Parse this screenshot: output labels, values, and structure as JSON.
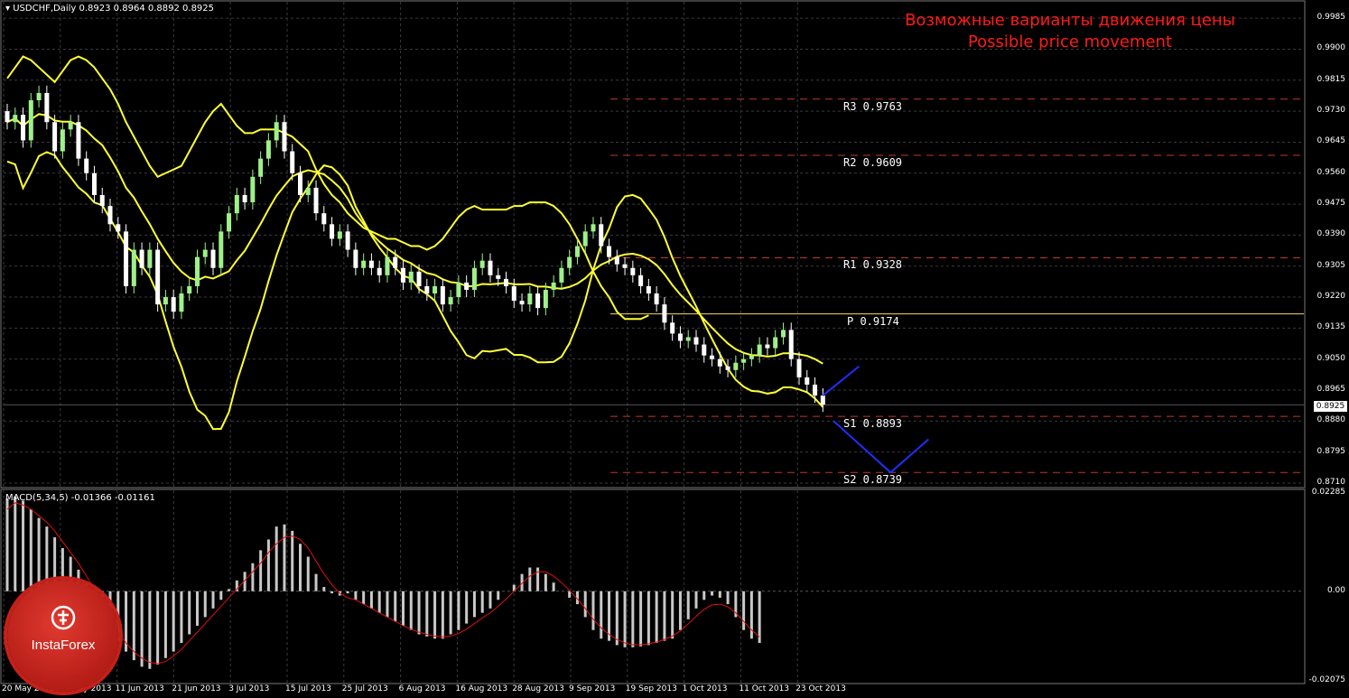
{
  "chart_data": [
    {
      "type": "candlestick",
      "title": "USDCHF,Daily",
      "ohlc_header": "0.8923 0.8964 0.8892 0.8925",
      "caption_line1": "Возможные варианты движения цены",
      "caption_line2": "Possible price movement",
      "y_ticks": [
        "0.9985",
        "0.9900",
        "0.9815",
        "0.9730",
        "0.9645",
        "0.9560",
        "0.9475",
        "0.9390",
        "0.9305",
        "0.9220",
        "0.9135",
        "0.9050",
        "0.8965",
        "0.8880",
        "0.8795",
        "0.8710"
      ],
      "ylim": [
        0.87,
        1.003
      ],
      "current_price": "0.8925",
      "x_ticks": [
        "20 May 2013",
        "30 May 2013",
        "11 Jun 2013",
        "21 Jun 2013",
        "3 Jul 2013",
        "15 Jul 2013",
        "25 Jul 2013",
        "6 Aug 2013",
        "16 Aug 2013",
        "28 Aug 2013",
        "9 Sep 2013",
        "19 Sep 2013",
        "1 Oct 2013",
        "11 Oct 2013",
        "23 Oct 2013"
      ],
      "levels": [
        {
          "name": "R3",
          "value": 0.9763,
          "text": "R3 0.9763",
          "color": "#c0392b"
        },
        {
          "name": "R2",
          "value": 0.9609,
          "text": "R2 0.9609",
          "color": "#c0392b"
        },
        {
          "name": "R1",
          "value": 0.9328,
          "text": "R1 0.9328",
          "color": "#c0392b"
        },
        {
          "name": "P",
          "value": 0.9174,
          "text": "P 0.9174",
          "color": "#f5d76e"
        },
        {
          "name": "S1",
          "value": 0.8893,
          "text": "S1 0.8893",
          "color": "#c0392b"
        },
        {
          "name": "S2",
          "value": 0.8739,
          "text": "S2 0.8739",
          "color": "#c0392b"
        }
      ],
      "close": [
        0.97,
        0.972,
        0.965,
        0.976,
        0.978,
        0.97,
        0.962,
        0.968,
        0.97,
        0.96,
        0.956,
        0.95,
        0.947,
        0.942,
        0.94,
        0.925,
        0.935,
        0.93,
        0.935,
        0.92,
        0.922,
        0.918,
        0.923,
        0.925,
        0.933,
        0.935,
        0.93,
        0.94,
        0.945,
        0.95,
        0.948,
        0.955,
        0.96,
        0.965,
        0.97,
        0.962,
        0.956,
        0.95,
        0.952,
        0.945,
        0.942,
        0.938,
        0.94,
        0.935,
        0.93,
        0.932,
        0.93,
        0.928,
        0.933,
        0.93,
        0.926,
        0.929,
        0.925,
        0.923,
        0.925,
        0.92,
        0.922,
        0.926,
        0.924,
        0.93,
        0.932,
        0.928,
        0.927,
        0.925,
        0.921,
        0.92,
        0.923,
        0.919,
        0.924,
        0.926,
        0.93,
        0.933,
        0.936,
        0.94,
        0.942,
        0.936,
        0.933,
        0.931,
        0.93,
        0.928,
        0.925,
        0.923,
        0.92,
        0.915,
        0.912,
        0.91,
        0.911,
        0.909,
        0.906,
        0.905,
        0.903,
        0.902,
        0.904,
        0.905,
        0.906,
        0.909,
        0.908,
        0.911,
        0.913,
        0.905,
        0.9,
        0.898,
        0.895,
        0.8925
      ],
      "bollinger_upper": [
        0.982,
        0.985,
        0.988,
        0.987,
        0.985,
        0.983,
        0.981,
        0.984,
        0.987,
        0.988,
        0.987,
        0.985,
        0.982,
        0.979,
        0.975,
        0.97,
        0.966,
        0.962,
        0.958,
        0.955,
        0.956,
        0.957,
        0.958,
        0.962,
        0.966,
        0.97,
        0.973,
        0.975,
        0.972,
        0.969,
        0.967,
        0.967,
        0.968,
        0.968,
        0.968,
        0.967,
        0.966,
        0.964,
        0.962,
        0.957,
        0.953,
        0.95,
        0.948,
        0.945,
        0.943,
        0.941,
        0.94,
        0.939,
        0.938,
        0.938,
        0.937,
        0.936,
        0.936,
        0.935,
        0.936,
        0.938,
        0.941,
        0.944,
        0.946,
        0.947,
        0.946,
        0.946,
        0.946,
        0.946,
        0.947,
        0.947,
        0.948,
        0.948,
        0.948,
        0.947,
        0.945,
        0.942,
        0.938,
        0.934,
        0.929,
        0.925,
        0.922,
        0.918,
        0.916,
        0.916,
        0.916,
        0.917
      ]
    },
    {
      "type": "histogram",
      "title": "MACD(5,34,5) -0.01366 -0.01161",
      "y_ticks": [
        "0.02285",
        "0.00",
        "-0.02075"
      ],
      "ylim": [
        -0.0212,
        0.0234
      ],
      "histogram": [
        0.0215,
        0.022,
        0.021,
        0.019,
        0.017,
        0.015,
        0.0125,
        0.01,
        0.008,
        0.005,
        0.002,
        -0.0015,
        -0.005,
        -0.0085,
        -0.0115,
        -0.014,
        -0.016,
        -0.0175,
        -0.018,
        -0.017,
        -0.0155,
        -0.014,
        -0.012,
        -0.01,
        -0.008,
        -0.006,
        -0.004,
        -0.002,
        0.0005,
        0.0025,
        0.0045,
        0.0065,
        0.0095,
        0.012,
        0.015,
        0.0155,
        0.014,
        0.011,
        0.008,
        0.004,
        0.001,
        -0.0005,
        -0.001,
        -0.0005,
        -0.002,
        -0.003,
        -0.004,
        -0.005,
        -0.006,
        -0.007,
        -0.008,
        -0.009,
        -0.01,
        -0.0105,
        -0.011,
        -0.011,
        -0.01,
        -0.009,
        -0.0075,
        -0.006,
        -0.005,
        -0.004,
        -0.002,
        0.0,
        0.0015,
        0.004,
        0.0055,
        0.0055,
        0.004,
        0.002,
        0.0,
        -0.0015,
        -0.003,
        -0.006,
        -0.009,
        -0.011,
        -0.0115,
        -0.0125,
        -0.013,
        -0.013,
        -0.0128,
        -0.0125,
        -0.012,
        -0.0115,
        -0.011,
        -0.009,
        -0.0065,
        -0.004,
        -0.002,
        -0.001,
        -0.0015,
        -0.003,
        -0.006,
        -0.009,
        -0.011,
        -0.012
      ],
      "signal": [
        0.019,
        0.0205,
        0.02,
        0.019,
        0.0175,
        0.016,
        0.014,
        0.0115,
        0.009,
        0.0065,
        0.0035,
        0.0005,
        -0.003,
        -0.0065,
        -0.0095,
        -0.012,
        -0.014,
        -0.0155,
        -0.0165,
        -0.0168,
        -0.0163,
        -0.015,
        -0.0135,
        -0.0115,
        -0.0095,
        -0.0075,
        -0.0055,
        -0.0035,
        -0.0015,
        0.0005,
        0.0025,
        0.0045,
        0.0065,
        0.009,
        0.011,
        0.0125,
        0.0128,
        0.012,
        0.01,
        0.007,
        0.004,
        0.0015,
        -0.0005,
        -0.0015,
        -0.002,
        -0.003,
        -0.004,
        -0.005,
        -0.006,
        -0.007,
        -0.008,
        -0.0088,
        -0.0095,
        -0.01,
        -0.0104,
        -0.0106,
        -0.0104,
        -0.0098,
        -0.0088,
        -0.0075,
        -0.0062,
        -0.005,
        -0.0035,
        -0.0018,
        0.0,
        0.0018,
        0.0035,
        0.0045,
        0.0045,
        0.0035,
        0.002,
        0.0002,
        -0.0018,
        -0.004,
        -0.0065,
        -0.0085,
        -0.01,
        -0.0112,
        -0.012,
        -0.0124,
        -0.0124,
        -0.0122,
        -0.0118,
        -0.0112,
        -0.0104,
        -0.0092,
        -0.0076,
        -0.0058,
        -0.0042,
        -0.0032,
        -0.003,
        -0.0036,
        -0.005,
        -0.007,
        -0.009,
        -0.0106
      ]
    }
  ],
  "brand": {
    "logo_text": "InstaForex"
  },
  "colors": {
    "bull": "#9ef08a",
    "bear": "#ffffff",
    "bollinger": "#ffff33",
    "projection": "#1f2fff",
    "macd_hist": "#c8c8c8",
    "macd_signal": "#e01010",
    "grid": "#3a3a3a"
  }
}
